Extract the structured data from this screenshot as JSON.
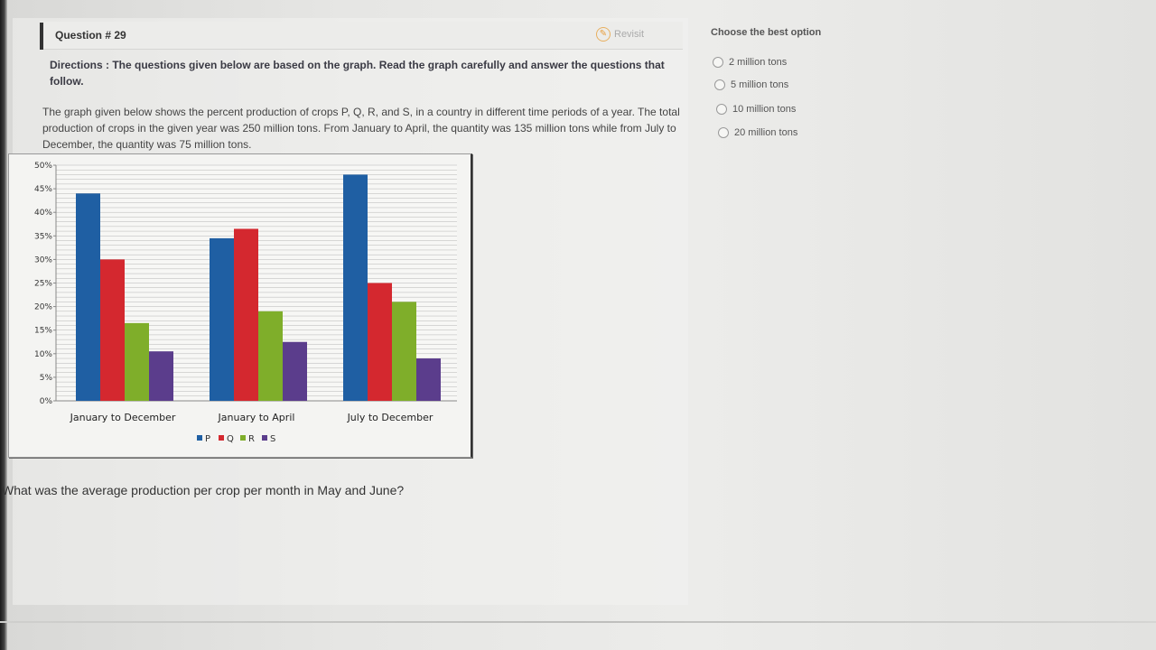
{
  "header": {
    "question_number": "Question # 29",
    "revisit_label": "Revisit"
  },
  "directions": "Directions : The questions given below are based on the graph. Read the graph carefully and answer the questions that follow.",
  "description": "The graph given below shows the percent production of crops P, Q, R, and S, in a country in different time periods of a year. The total production of crops in the given year was 250 million tons. From January to April, the quantity was 135 million tons while from July to December, the quantity was 75 million tons.",
  "question": "What was the average production per crop per month in May and June?",
  "options_panel": {
    "header": "Choose the best option",
    "options": [
      "2 million tons",
      "5 million tons",
      "10 million tons",
      "20 million tons"
    ]
  },
  "chart_data": {
    "type": "bar",
    "categories": [
      "January to December",
      "January to April",
      "July to December"
    ],
    "series": [
      {
        "name": "P",
        "color": "#1f5fa3",
        "values": [
          44,
          34.5,
          48
        ]
      },
      {
        "name": "Q",
        "color": "#d4282f",
        "values": [
          30,
          36.5,
          25
        ]
      },
      {
        "name": "R",
        "color": "#7fae2a",
        "values": [
          16.5,
          19,
          21
        ]
      },
      {
        "name": "S",
        "color": "#5b3d8c",
        "values": [
          10.5,
          12.5,
          9
        ]
      }
    ],
    "yticks": [
      "0%",
      "5%",
      "10%",
      "15%",
      "20%",
      "25%",
      "30%",
      "35%",
      "40%",
      "45%",
      "50%"
    ],
    "ylim": [
      0,
      50
    ],
    "grid": true,
    "legend_position": "bottom"
  }
}
